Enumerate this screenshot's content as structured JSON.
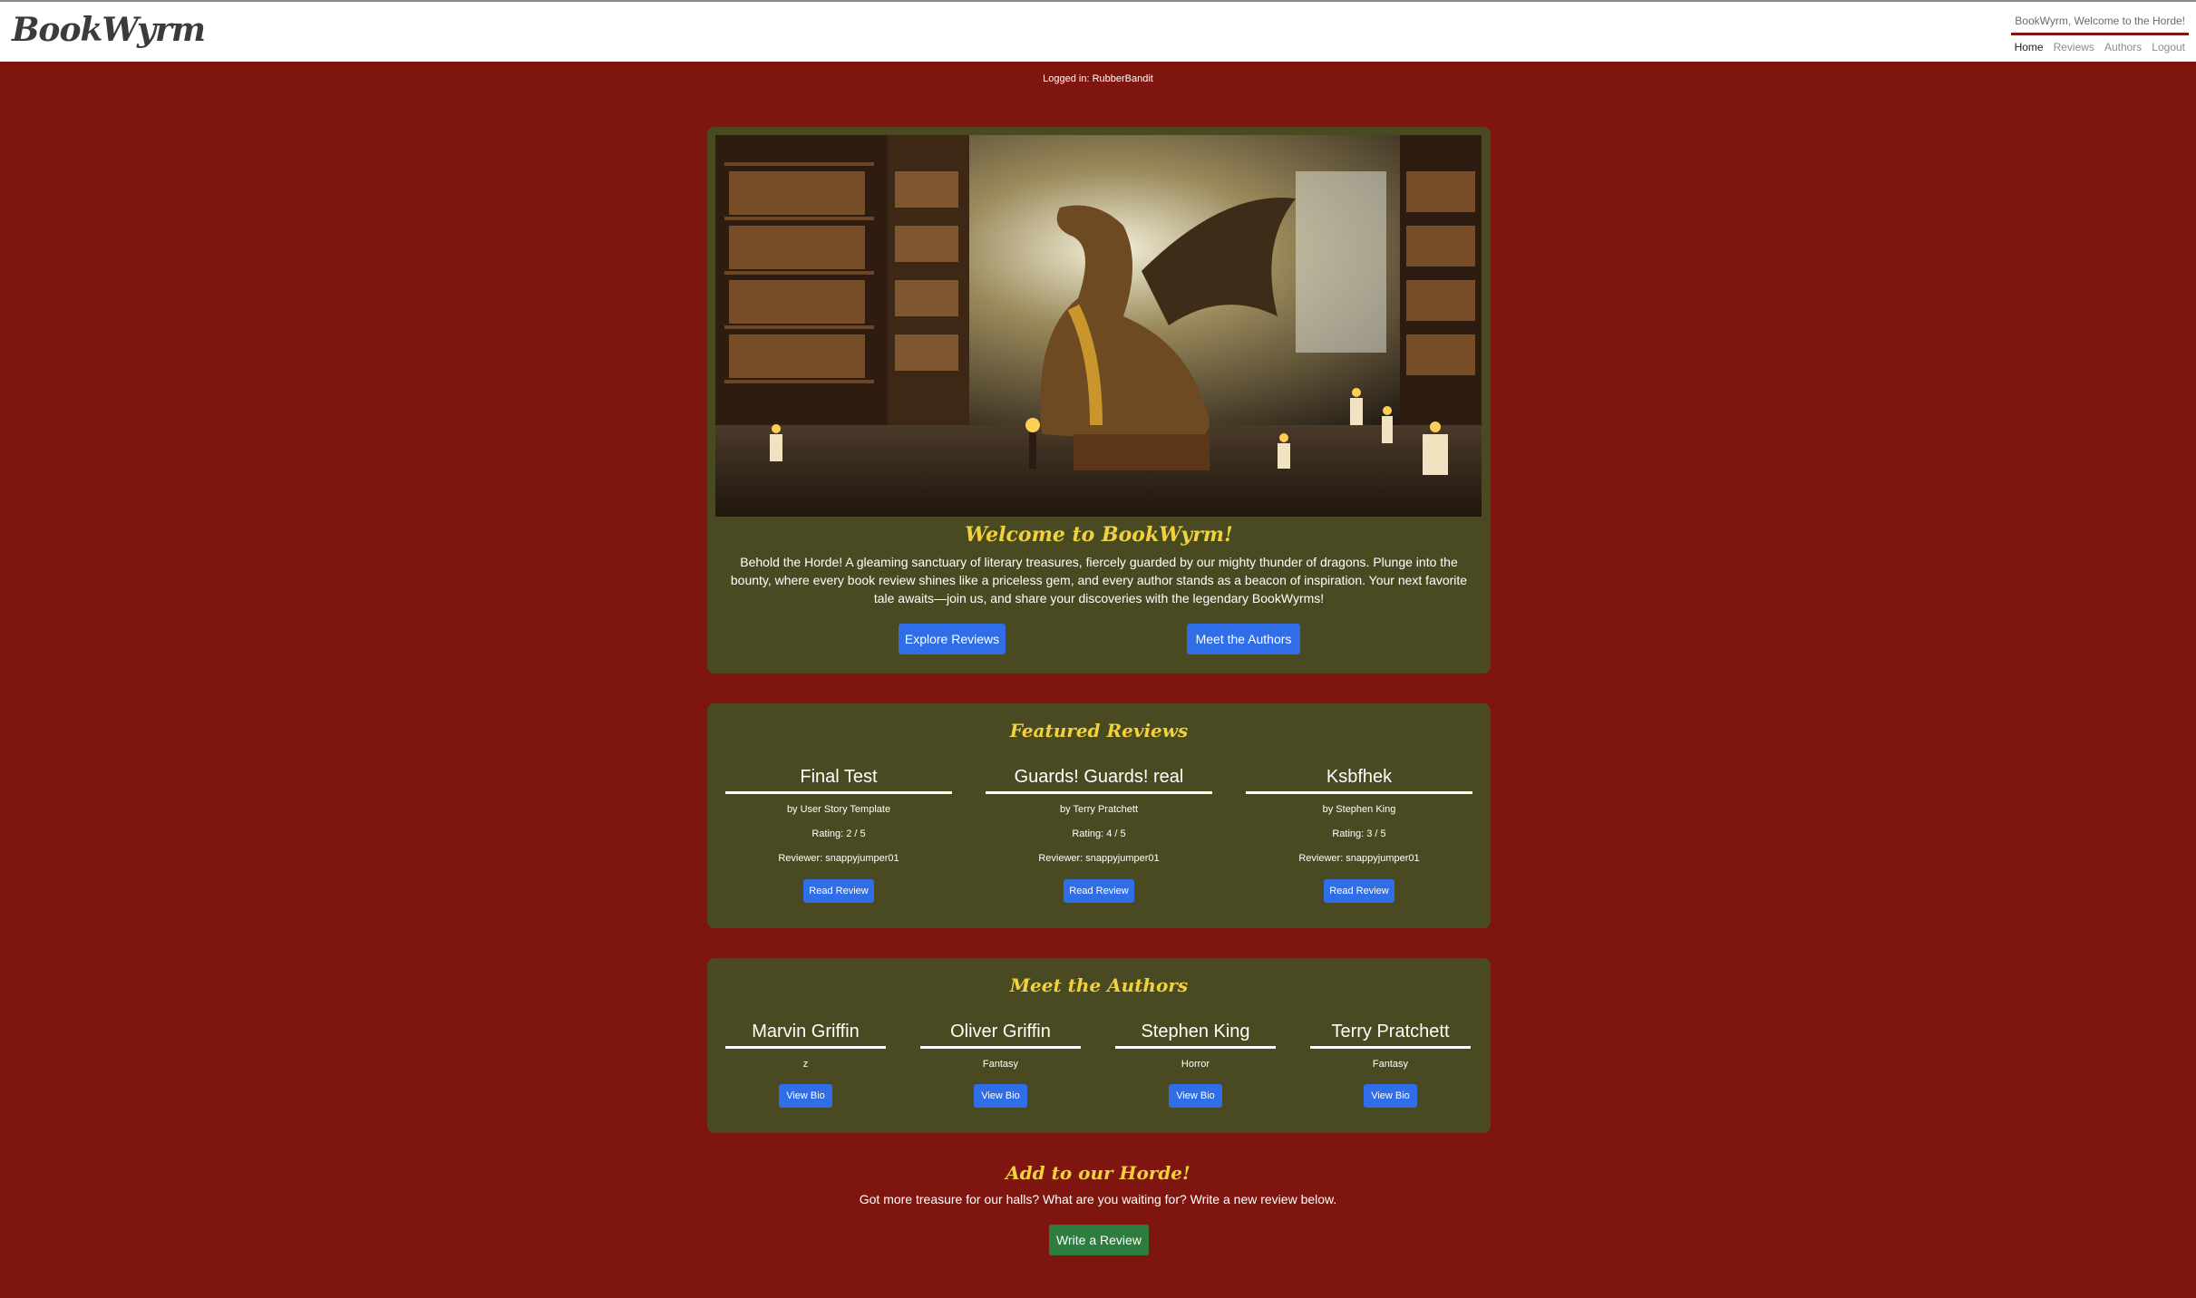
{
  "header": {
    "logo": "BookWyrm",
    "tagline": "BookWyrm, Welcome to the Horde!",
    "nav": [
      "Home",
      "Reviews",
      "Authors",
      "Logout"
    ]
  },
  "status": {
    "logged_in": "Logged in: RubberBandit"
  },
  "hero": {
    "title": "Welcome to BookWyrm!",
    "text": "Behold the Horde! A gleaming sanctuary of literary treasures, fiercely guarded by our mighty thunder of dragons. Plunge into the bounty, where every book review shines like a priceless gem, and every author stands as a beacon of inspiration. Your next favorite tale awaits—join us, and share your discoveries with the legendary BookWyrms!",
    "explore_label": "Explore Reviews",
    "meet_label": "Meet the Authors"
  },
  "featured": {
    "title": "Featured Reviews",
    "reviews": [
      {
        "title": "Final Test",
        "author": "by User Story Template",
        "rating": "Rating: 2 / 5",
        "reviewer": "Reviewer: snappyjumper01",
        "button": "Read Review"
      },
      {
        "title": "Guards! Guards! real",
        "author": "by Terry Pratchett",
        "rating": "Rating: 4 / 5",
        "reviewer": "Reviewer: snappyjumper01",
        "button": "Read Review"
      },
      {
        "title": "Ksbfhek",
        "author": "by Stephen King",
        "rating": "Rating: 3 / 5",
        "reviewer": "Reviewer: snappyjumper01",
        "button": "Read Review"
      }
    ]
  },
  "authors": {
    "title": "Meet the Authors",
    "list": [
      {
        "name": "Marvin Griffin",
        "genre": "z",
        "button": "View Bio"
      },
      {
        "name": "Oliver Griffin",
        "genre": "Fantasy",
        "button": "View Bio"
      },
      {
        "name": "Stephen King",
        "genre": "Horror",
        "button": "View Bio"
      },
      {
        "name": "Terry Pratchett",
        "genre": "Fantasy",
        "button": "View Bio"
      }
    ]
  },
  "cta": {
    "title": "Add to our Horde!",
    "text": "Got more treasure for our halls? What are you waiting for? Write a new review below.",
    "button": "Write a Review"
  },
  "colors": {
    "background": "#7e150f",
    "panel": "#4a4a22",
    "accent_yellow": "#f2d23c",
    "button_blue": "#2f6ee8",
    "button_green": "#2e7d3e"
  }
}
